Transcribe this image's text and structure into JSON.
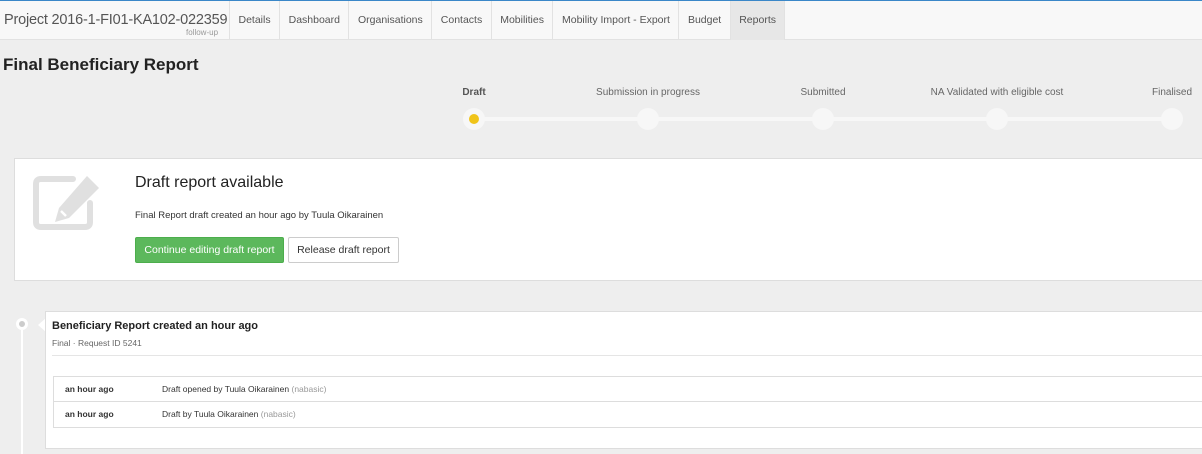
{
  "header": {
    "project": "Project 2016-1-FI01-KA102-022359",
    "project_sub": "follow-up",
    "tabs": [
      "Details",
      "Dashboard",
      "Organisations",
      "Contacts",
      "Mobilities",
      "Mobility Import - Export",
      "Budget",
      "Reports"
    ],
    "active_tab": "Reports"
  },
  "page_title": "Final Beneficiary Report",
  "status": {
    "steps": [
      "Draft",
      "Submission in progress",
      "Submitted",
      "NA Validated with eligible cost",
      "Finalised"
    ],
    "current": "Draft",
    "current_color": "#f0c419"
  },
  "draft": {
    "title": "Draft report available",
    "text": "Final Report draft created an hour ago by Tuula Oikarainen",
    "continue_label": "Continue editing draft report",
    "release_label": "Release draft report",
    "icon": "edit-icon"
  },
  "timeline": {
    "title": "Beneficiary Report created an hour ago",
    "subtitle": "Final · Request ID 5241",
    "rows": [
      {
        "time": "an hour ago",
        "message": "Draft opened by Tuula Oikarainen",
        "user": "(nabasic)"
      },
      {
        "time": "an hour ago",
        "message": "Draft by Tuula Oikarainen",
        "user": "(nabasic)"
      }
    ]
  },
  "colors": {
    "primary": "#5cb85c",
    "accent": "#3a87c8"
  }
}
